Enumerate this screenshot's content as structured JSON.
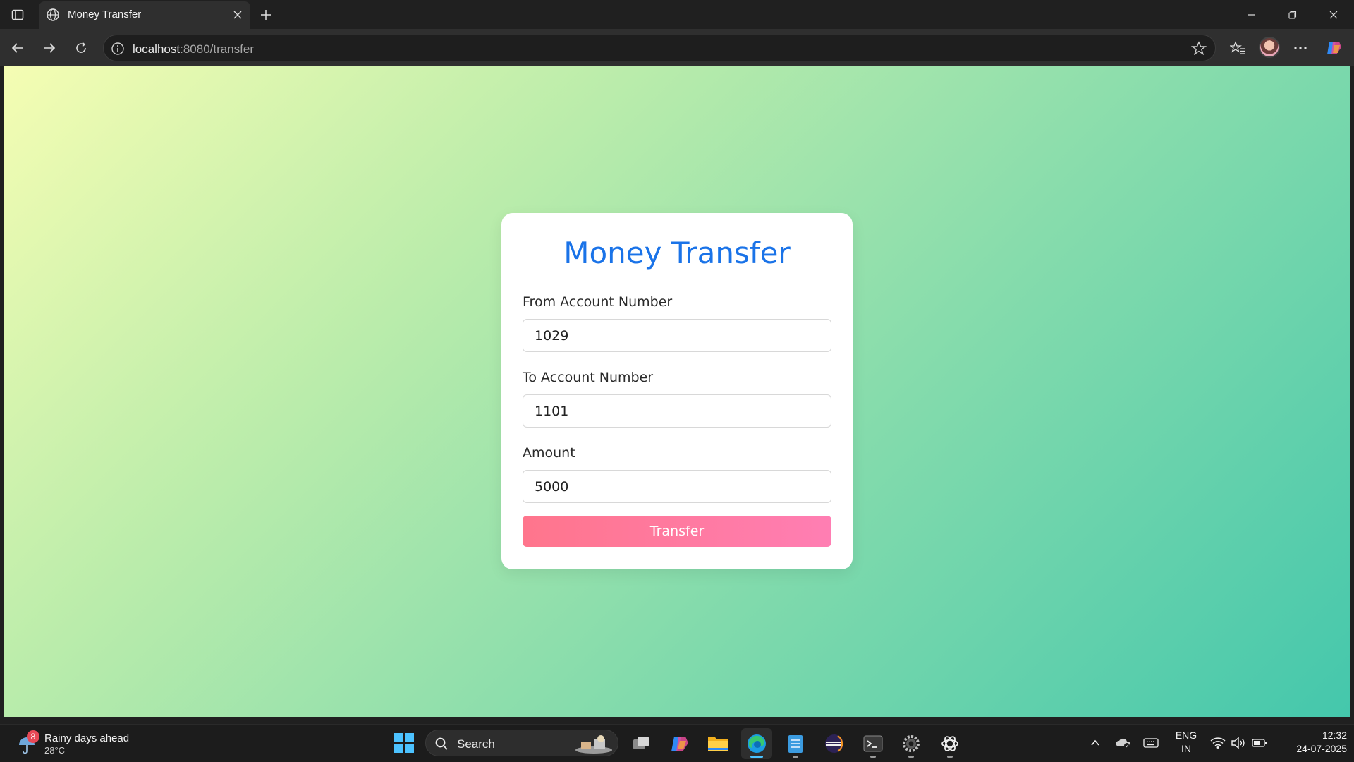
{
  "browser": {
    "tab_title": "Money Transfer",
    "url_host": "localhost",
    "url_path": ":8080/transfer"
  },
  "page": {
    "title": "Money Transfer",
    "from_label": "From Account Number",
    "from_value": "1029",
    "to_label": "To Account Number",
    "to_value": "1101",
    "amount_label": "Amount",
    "amount_value": "5000",
    "submit_label": "Transfer",
    "title_color": "#1a73e8",
    "button_color": "#ff758c"
  },
  "taskbar": {
    "weather_text": "Rainy days ahead",
    "weather_temp": "28°C",
    "weather_badge": "8",
    "search_label": "Search",
    "lang_line1": "ENG",
    "lang_line2": "IN",
    "time": "12:32",
    "date": "24-07-2025",
    "apps": [
      "task-view",
      "copilot",
      "file-explorer",
      "edge",
      "notepad",
      "eclipse",
      "terminal",
      "settings",
      "chatgpt"
    ]
  }
}
